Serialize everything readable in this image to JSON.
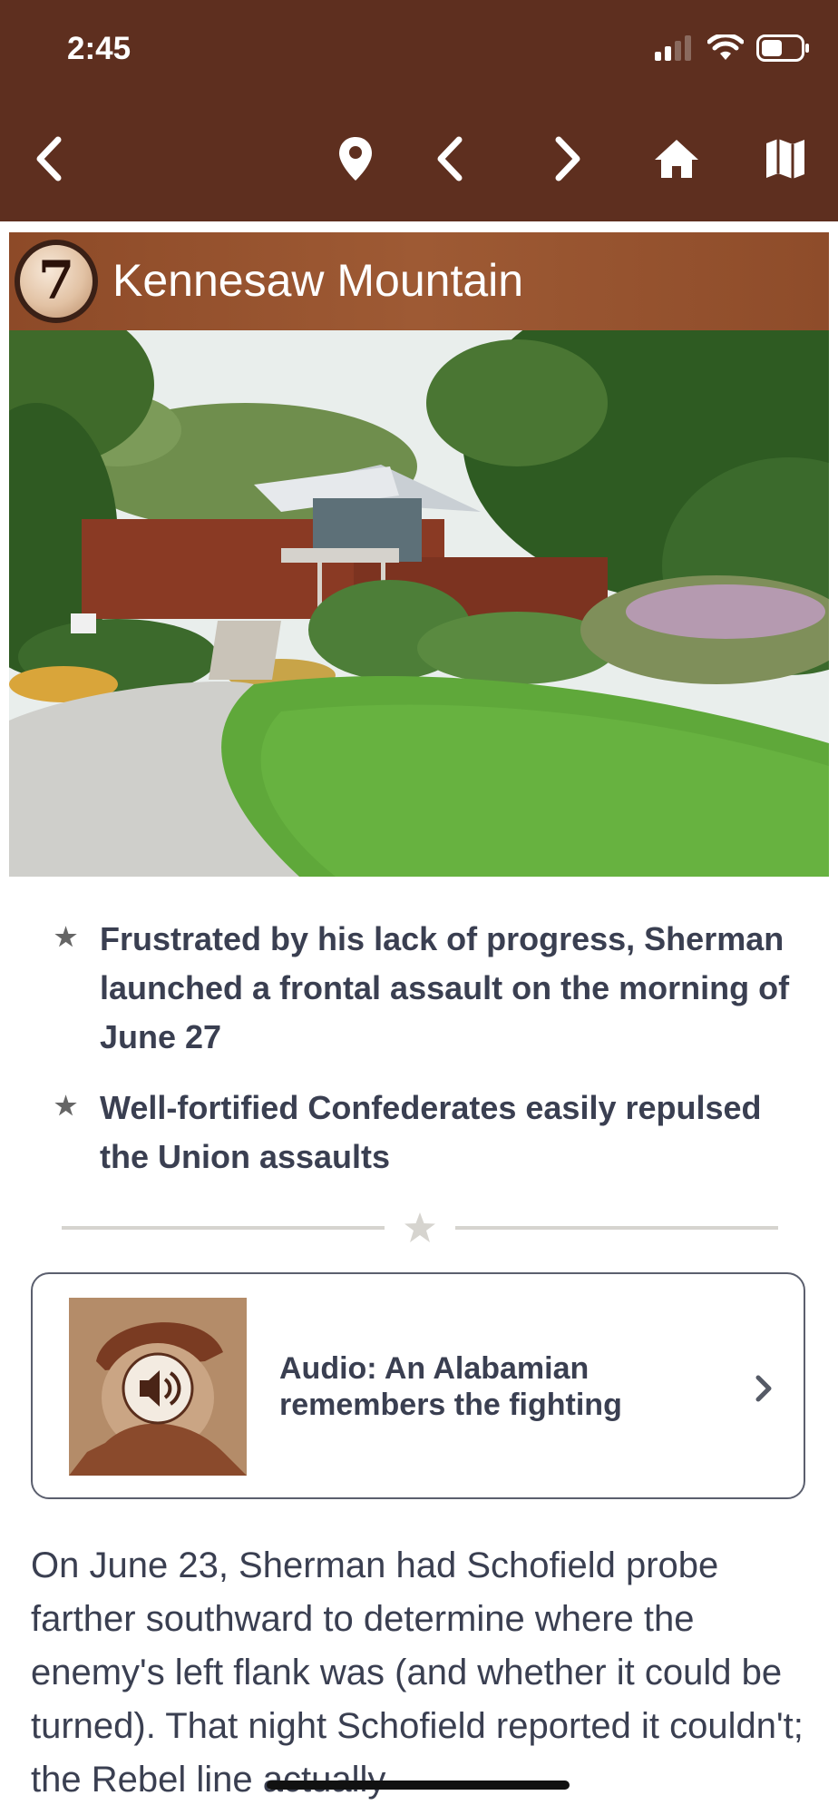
{
  "status_bar": {
    "time": "2:45"
  },
  "toolbar": {
    "back_icon": "chevron-left-icon",
    "location_icon": "map-pin-icon",
    "prev_icon": "chevron-left-icon",
    "next_icon": "chevron-right-icon",
    "home_icon": "home-icon",
    "map_icon": "map-icon"
  },
  "stop": {
    "number": "7",
    "title": "Kennesaw Mountain"
  },
  "bullets": [
    "Frustrated by his lack of progress, Sherman launched a frontal assault on the morning of June 27",
    "Well-fortified Confederates easily repulsed the Union assaults"
  ],
  "audio": {
    "title": "Audio: An Alabamian remembers the fighting"
  },
  "body": "On June 23, Sherman had Schofield probe farther southward to determine where the enemy's left flank was (and whether it could be turned). That night Schofield reported it couldn't; the Rebel line actually",
  "colors": {
    "topbar": "#5e2f1f",
    "title_band": "#9a5631",
    "text": "#3a3f51"
  }
}
